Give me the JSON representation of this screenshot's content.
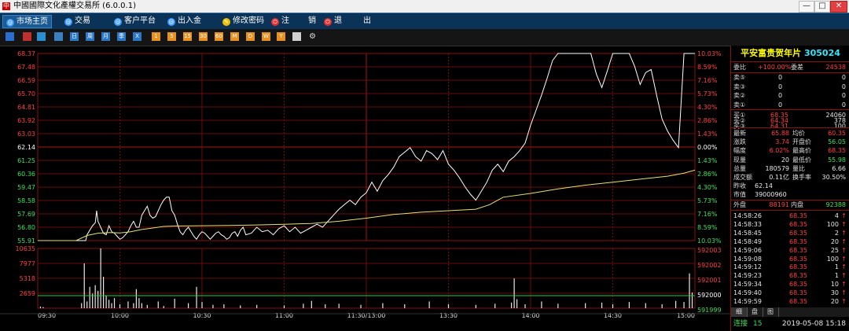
{
  "window": {
    "title": "中國國際文化產權交易所 (6.0.0.1)",
    "app_icon": "中",
    "min_label": "—",
    "max_label": "□",
    "close_label": "✕"
  },
  "menu": {
    "items": [
      {
        "label": "市场主页",
        "icon": "globe-icon",
        "icon_char": "@",
        "icon_color": "#3a9bff"
      },
      {
        "label": "交易",
        "icon": "globe-icon",
        "icon_char": "@",
        "icon_color": "#3a9bff"
      },
      {
        "label": "客户平台",
        "icon": "globe-icon",
        "icon_char": "@",
        "icon_color": "#3a9bff"
      },
      {
        "label": "出入金",
        "icon": "globe-icon",
        "icon_char": "@",
        "icon_color": "#3a9bff"
      },
      {
        "label": "修改密码",
        "icon": "key-icon",
        "icon_char": "✎",
        "icon_color": "#f0c000"
      },
      {
        "label": "注",
        "icon": "power-icon",
        "icon_char": "⏻",
        "icon_color": "#e03030"
      },
      {
        "label": "销",
        "icon": "",
        "icon_char": "",
        "icon_color": ""
      },
      {
        "label": "退",
        "icon": "power-icon",
        "icon_char": "⏻",
        "icon_color": "#e03030"
      },
      {
        "label": "出",
        "icon": "",
        "icon_char": "",
        "icon_color": ""
      }
    ]
  },
  "toolbar": {
    "buttons": [
      {
        "icon": "bar-chart-icon",
        "label": "",
        "color": "#2a6fd0"
      },
      {
        "icon": "line-chart-icon",
        "label": "",
        "color": "#c03030"
      },
      {
        "icon": "candlestick-icon",
        "label": "",
        "color": "#2a8fd0"
      },
      {
        "icon": "list-icon",
        "label": "",
        "color": "#3a7fc0"
      },
      {
        "icon": "day-icon",
        "label": "日",
        "color": "#2a78c8"
      },
      {
        "icon": "week-icon",
        "label": "周",
        "color": "#2a78c8"
      },
      {
        "icon": "month-icon",
        "label": "月",
        "color": "#2a78c8"
      },
      {
        "icon": "quarter-icon",
        "label": "季",
        "color": "#2a78c8"
      },
      {
        "icon": "close-icon",
        "label": "X",
        "color": "#2a78c8"
      },
      {
        "icon": "indicator-1-icon",
        "label": "1",
        "color": "#e89020"
      },
      {
        "icon": "indicator-2-icon",
        "label": "5",
        "color": "#e89020"
      },
      {
        "icon": "indicator-3-icon",
        "label": "15",
        "color": "#e89020"
      },
      {
        "icon": "indicator-4-icon",
        "label": "30",
        "color": "#e89020"
      },
      {
        "icon": "indicator-5-icon",
        "label": "60",
        "color": "#e89020"
      },
      {
        "icon": "indicator-6-icon",
        "label": "M",
        "color": "#e89020"
      },
      {
        "icon": "indicator-7-icon",
        "label": "D",
        "color": "#e89020"
      },
      {
        "icon": "indicator-8-icon",
        "label": "W",
        "color": "#e89020"
      },
      {
        "icon": "indicator-9-icon",
        "label": "Y",
        "color": "#e89020"
      },
      {
        "icon": "draw-icon",
        "label": "",
        "color": "#d0d0d0"
      },
      {
        "icon": "gear-icon",
        "label": "⚙",
        "color": "#000000"
      }
    ]
  },
  "chart_data": {
    "type": "line",
    "title": "平安富贵贺年片 305024",
    "prev_close": 62.14,
    "price_ticks": [
      68.37,
      67.48,
      66.59,
      65.7,
      64.81,
      63.92,
      63.03,
      62.14,
      61.25,
      60.36,
      59.47,
      58.58,
      57.69,
      56.8,
      55.91
    ],
    "pct_ticks": [
      "10.03%",
      "8.59%",
      "7.16%",
      "5.73%",
      "4.30%",
      "2.86%",
      "1.43%",
      "0.00%",
      "1.43%",
      "2.86%",
      "4.30%",
      "5.73%",
      "7.16%",
      "8.59%",
      "10.03%"
    ],
    "vol_ticks": [
      10635,
      7977,
      5318,
      2659
    ],
    "oi_ticks": [
      592003,
      592002,
      592001,
      592000,
      591999
    ],
    "time_labels": [
      "09:30",
      "10:00",
      "10:30",
      "11:00",
      "11:30/13:00",
      "13:30",
      "14:00",
      "14:30",
      "15:00"
    ],
    "ylim": [
      55.91,
      68.37
    ],
    "series": [
      {
        "x": [
          0,
          7,
          14,
          17.5,
          18,
          20,
          21,
          21.5,
          22,
          23,
          24,
          25,
          26,
          27,
          28,
          29,
          30,
          31,
          33,
          34,
          35,
          36,
          37,
          38,
          39,
          40,
          41,
          42,
          43,
          44,
          45,
          46,
          47,
          48,
          49,
          50,
          51,
          52,
          53,
          54,
          55,
          56,
          57,
          58,
          59,
          60,
          61,
          62,
          63,
          64,
          65,
          66,
          67,
          68,
          69,
          70,
          71,
          72,
          73,
          74,
          75,
          76,
          78,
          80,
          82,
          84,
          86,
          88,
          90,
          92,
          94,
          96,
          98,
          100,
          102,
          104,
          106,
          107,
          108,
          110,
          112,
          114,
          116,
          118,
          120,
          122,
          124,
          126,
          128,
          130,
          132,
          134,
          136,
          138,
          140,
          142,
          144,
          146,
          148,
          150,
          152,
          154,
          156,
          158,
          160,
          162,
          164,
          166,
          168,
          170,
          172,
          174,
          176,
          178,
          180,
          182,
          184,
          186,
          188,
          190,
          192,
          194,
          196,
          198,
          200,
          202,
          204,
          206,
          208,
          210,
          212,
          214,
          216,
          218,
          220,
          222,
          224,
          226,
          228,
          230,
          232,
          234,
          236,
          238,
          240
        ],
        "values": [
          55.91,
          55.91,
          55.91,
          55.91,
          56.3,
          56.9,
          57.1,
          57.9,
          57.2,
          56.8,
          56.4,
          56.3,
          56.9,
          56.5,
          56.4,
          56.2,
          56.0,
          56.1,
          56.5,
          56.9,
          57.2,
          56.8,
          56.8,
          57.6,
          57.9,
          58.2,
          57.6,
          57.4,
          57.5,
          57.9,
          58.3,
          58.6,
          58.8,
          58.8,
          57.9,
          57.6,
          57.0,
          56.5,
          56.3,
          56.6,
          56.8,
          56.5,
          56.2,
          56.0,
          56.3,
          56.5,
          56.4,
          56.2,
          56.0,
          56.2,
          56.4,
          56.5,
          56.3,
          56.2,
          56.0,
          56.1,
          56.4,
          56.5,
          56.2,
          56.6,
          56.8,
          56.3,
          56.4,
          56.8,
          56.5,
          56.6,
          56.3,
          56.7,
          56.9,
          56.5,
          56.8,
          56.4,
          56.6,
          56.8,
          57.0,
          56.8,
          57.2,
          57.4,
          57.6,
          58.0,
          58.3,
          58.6,
          58.3,
          58.8,
          59.1,
          59.8,
          59.2,
          59.9,
          60.3,
          60.8,
          61.5,
          61.8,
          62.1,
          61.5,
          61.2,
          61.9,
          61.7,
          61.3,
          61.9,
          61.0,
          60.6,
          60.1,
          59.5,
          59.0,
          58.6,
          59.2,
          59.8,
          60.6,
          61.0,
          60.5,
          61.2,
          61.5,
          61.9,
          62.4,
          63.6,
          64.6,
          65.6,
          66.7,
          67.9,
          68.37,
          68.37,
          68.37,
          68.37,
          68.37,
          68.37,
          68.37,
          67.0,
          66.1,
          67.2,
          68.37,
          68.37,
          68.37,
          68.37,
          67.5,
          66.3,
          67.1,
          67.3,
          65.6,
          64.0,
          63.2,
          62.6,
          62.1,
          68.37,
          68.37,
          68.37
        ],
        "name": "price"
      },
      {
        "x": [
          0,
          14,
          18,
          22,
          26,
          30,
          34,
          38,
          42,
          46,
          50,
          60,
          70,
          80,
          90,
          100,
          110,
          120,
          130,
          140,
          150,
          160,
          165,
          170,
          180,
          190,
          200,
          210,
          220,
          230,
          236,
          240
        ],
        "values": [
          55.91,
          55.91,
          56.25,
          56.4,
          56.45,
          56.42,
          56.5,
          56.65,
          56.75,
          56.85,
          56.88,
          56.9,
          56.92,
          56.95,
          57.0,
          57.05,
          57.2,
          57.4,
          57.65,
          57.8,
          57.9,
          58.0,
          58.3,
          58.8,
          59.05,
          59.35,
          59.6,
          59.8,
          60.0,
          60.2,
          60.4,
          60.6
        ],
        "name": "avg"
      }
    ],
    "volume": [
      {
        "t": 1,
        "v": 300
      },
      {
        "t": 2,
        "v": 200
      },
      {
        "t": 16,
        "v": 900
      },
      {
        "t": 17,
        "v": 7977
      },
      {
        "t": 18,
        "v": 1200
      },
      {
        "t": 19,
        "v": 3800
      },
      {
        "t": 20,
        "v": 2600
      },
      {
        "t": 21,
        "v": 4100
      },
      {
        "t": 22,
        "v": 3100
      },
      {
        "t": 23,
        "v": 10635
      },
      {
        "t": 24,
        "v": 5600
      },
      {
        "t": 25,
        "v": 2200
      },
      {
        "t": 26,
        "v": 1500
      },
      {
        "t": 27,
        "v": 900
      },
      {
        "t": 28,
        "v": 1800
      },
      {
        "t": 30,
        "v": 700
      },
      {
        "t": 33,
        "v": 1200
      },
      {
        "t": 35,
        "v": 900
      },
      {
        "t": 36,
        "v": 3400
      },
      {
        "t": 37,
        "v": 1800
      },
      {
        "t": 38,
        "v": 900
      },
      {
        "t": 40,
        "v": 600
      },
      {
        "t": 44,
        "v": 1200
      },
      {
        "t": 46,
        "v": 400
      },
      {
        "t": 50,
        "v": 1700
      },
      {
        "t": 55,
        "v": 900
      },
      {
        "t": 58,
        "v": 3800
      },
      {
        "t": 60,
        "v": 1100
      },
      {
        "t": 64,
        "v": 600
      },
      {
        "t": 68,
        "v": 700
      },
      {
        "t": 74,
        "v": 500
      },
      {
        "t": 80,
        "v": 600
      },
      {
        "t": 90,
        "v": 500
      },
      {
        "t": 97,
        "v": 800
      },
      {
        "t": 100,
        "v": 1300
      },
      {
        "t": 105,
        "v": 700
      },
      {
        "t": 110,
        "v": 800
      },
      {
        "t": 118,
        "v": 600
      },
      {
        "t": 126,
        "v": 900
      },
      {
        "t": 134,
        "v": 700
      },
      {
        "t": 143,
        "v": 1200
      },
      {
        "t": 150,
        "v": 700
      },
      {
        "t": 160,
        "v": 600
      },
      {
        "t": 167,
        "v": 800
      },
      {
        "t": 173,
        "v": 1000
      },
      {
        "t": 174,
        "v": 5300
      },
      {
        "t": 175,
        "v": 1600
      },
      {
        "t": 178,
        "v": 700
      },
      {
        "t": 184,
        "v": 1200
      },
      {
        "t": 190,
        "v": 800
      },
      {
        "t": 200,
        "v": 900
      },
      {
        "t": 206,
        "v": 1000
      },
      {
        "t": 210,
        "v": 700
      },
      {
        "t": 216,
        "v": 1100
      },
      {
        "t": 222,
        "v": 900
      },
      {
        "t": 228,
        "v": 700
      },
      {
        "t": 233,
        "v": 1300
      },
      {
        "t": 236,
        "v": 1100
      },
      {
        "t": 238,
        "v": 6200
      },
      {
        "t": 239,
        "v": 2800
      }
    ],
    "xlabel": "",
    "ylabel": ""
  },
  "quote": {
    "name": "平安富贵贺年片",
    "code": "305024",
    "weibi_label": "委比",
    "weibi_value": "+100.00%",
    "weicha_label": "委差",
    "weicha_value": "24538",
    "asks": [
      {
        "label": "卖⑤",
        "price": "0",
        "vol": "0"
      },
      {
        "label": "卖③",
        "price": "0",
        "vol": "0"
      },
      {
        "label": "卖②",
        "price": "0",
        "vol": "0"
      },
      {
        "label": "卖①",
        "price": "0",
        "vol": "0"
      }
    ],
    "bids": [
      {
        "label": "买①",
        "price": "68.35",
        "vol": "24060"
      },
      {
        "label": "买②",
        "price": "64.34",
        "vol": "378"
      },
      {
        "label": "买③",
        "price": "64.31",
        "vol": "100"
      }
    ],
    "stats": [
      {
        "l1": "最新",
        "v1": "65.88",
        "c1": "r",
        "l2": "均价",
        "v2": "60.35",
        "c2": "r"
      },
      {
        "l1": "涨跌",
        "v1": "3.74",
        "c1": "r",
        "l2": "开盘价",
        "v2": "56.05",
        "c2": "g"
      },
      {
        "l1": "幅度",
        "v1": "6.02%",
        "c1": "r",
        "l2": "最高价",
        "v2": "68.35",
        "c2": "r"
      },
      {
        "l1": "现量",
        "v1": "20",
        "c1": "w",
        "l2": "最低价",
        "v2": "55.98",
        "c2": "g"
      },
      {
        "l1": "总量",
        "v1": "180579",
        "c1": "w",
        "l2": "量比",
        "v2": "6.66",
        "c2": "w"
      },
      {
        "l1": "成交额",
        "v1": "0.11亿",
        "c1": "w",
        "l2": "换手率",
        "v2": "30.50%",
        "c2": "w"
      },
      {
        "l1": "昨收",
        "v1": "62.14",
        "c1": "w",
        "l2": "",
        "v2": "",
        "c2": "w"
      },
      {
        "l1": "市值",
        "v1": "39000960",
        "c1": "w",
        "l2": "",
        "v2": "",
        "c2": "w"
      }
    ],
    "waipan_label": "外盘",
    "waipan_value": "88191",
    "neipan_label": "内盘",
    "neipan_value": "92388",
    "trades": [
      {
        "time": "14:58:26",
        "price": "68.35",
        "vol": "4"
      },
      {
        "time": "14:58:33",
        "price": "68.35",
        "vol": "100"
      },
      {
        "time": "14:58:45",
        "price": "68.35",
        "vol": "2"
      },
      {
        "time": "14:58:49",
        "price": "68.35",
        "vol": "20"
      },
      {
        "time": "14:59:06",
        "price": "68.35",
        "vol": "25"
      },
      {
        "time": "14:59:08",
        "price": "68.35",
        "vol": "100"
      },
      {
        "time": "14:59:12",
        "price": "68.35",
        "vol": "1"
      },
      {
        "time": "14:59:23",
        "price": "68.35",
        "vol": "1"
      },
      {
        "time": "14:59:34",
        "price": "68.35",
        "vol": "10"
      },
      {
        "time": "14:59:40",
        "price": "68.35",
        "vol": "30"
      },
      {
        "time": "14:59:59",
        "price": "68.35",
        "vol": "20"
      }
    ],
    "trade_arrow": "↑",
    "tabs": [
      "细",
      "盘",
      "图"
    ],
    "status_connected": "连接",
    "status_count": "15",
    "status_datetime": "2019-05-08  15:18"
  },
  "colors": {
    "grid": "#8a1010",
    "price_line": "#ffffff",
    "avg_line": "#e8e070",
    "volume_bar": "#e8e8e8",
    "oi_line": "#22cc44",
    "up": "#ff4040",
    "down": "#3ee05a"
  }
}
